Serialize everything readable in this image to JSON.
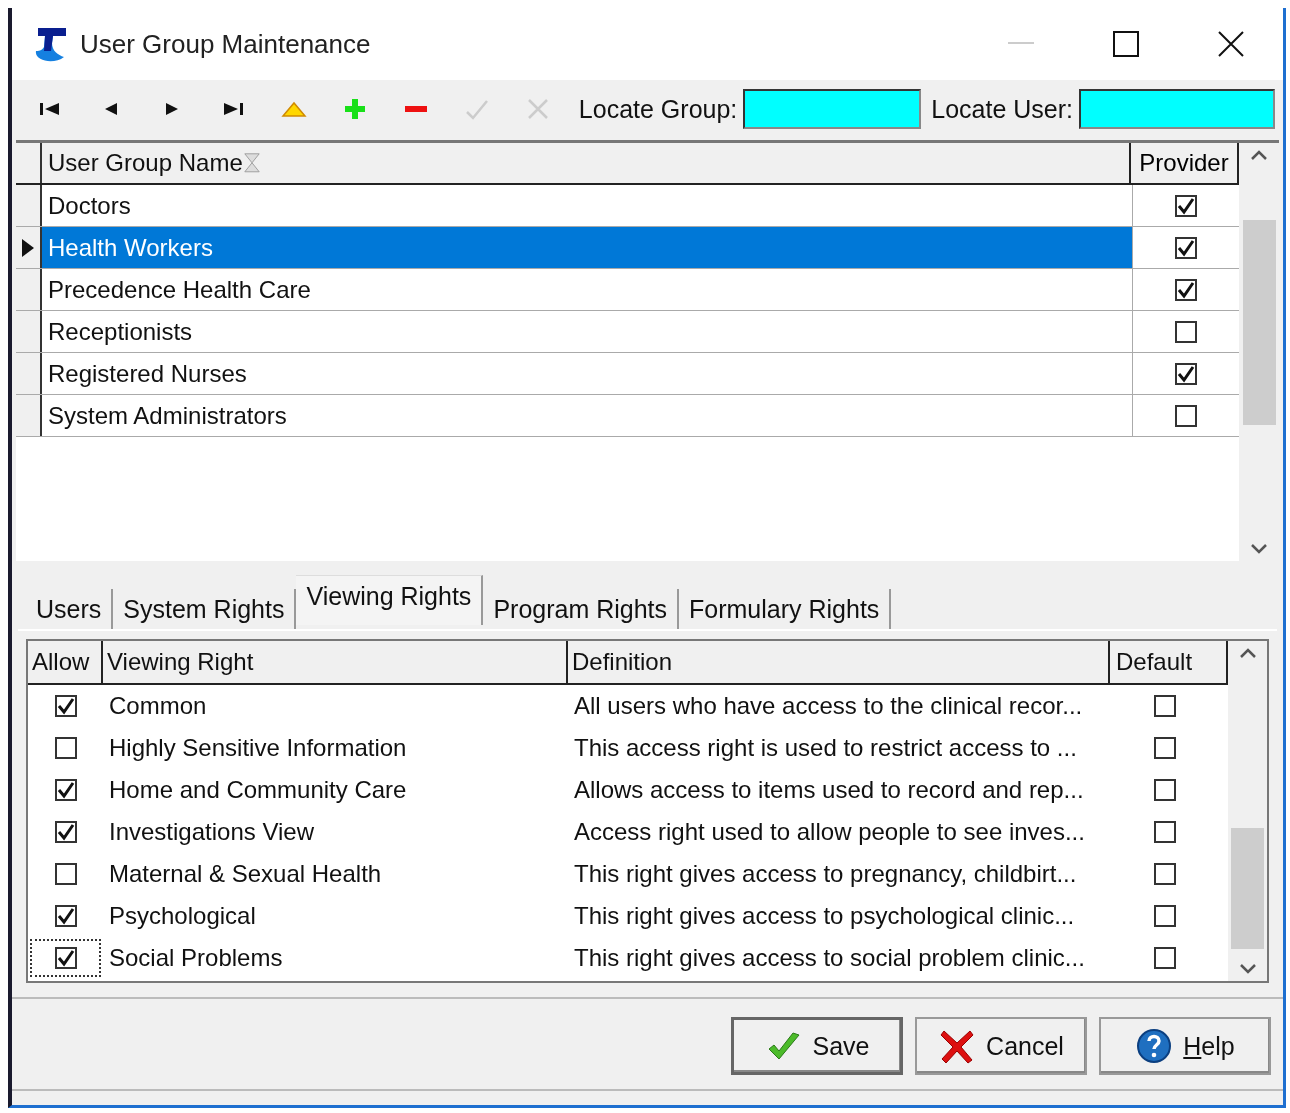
{
  "window": {
    "title": "User Group Maintenance"
  },
  "toolbar": {
    "buttons": [
      {
        "kind": "first",
        "disabled": false
      },
      {
        "kind": "prior",
        "disabled": false
      },
      {
        "kind": "next",
        "disabled": false
      },
      {
        "kind": "last",
        "disabled": false
      },
      {
        "kind": "edit",
        "disabled": false
      },
      {
        "kind": "insert",
        "disabled": false
      },
      {
        "kind": "delete",
        "disabled": false
      },
      {
        "kind": "post",
        "disabled": true
      },
      {
        "kind": "cancel",
        "disabled": true
      }
    ],
    "locate_group": {
      "label": "Locate Group:"
    },
    "locate_user": {
      "label": "Locate User:"
    }
  },
  "groups": {
    "columns": [
      "User Group Name",
      "Provider"
    ],
    "rows": [
      {
        "name": "Doctors",
        "provider": true,
        "selected": false
      },
      {
        "name": "Health Workers",
        "provider": true,
        "selected": true
      },
      {
        "name": "Precedence Health Care",
        "provider": true,
        "selected": false
      },
      {
        "name": "Receptionists",
        "provider": false,
        "selected": false
      },
      {
        "name": "Registered Nurses",
        "provider": true,
        "selected": false
      },
      {
        "name": "System Administrators",
        "provider": false,
        "selected": false
      }
    ]
  },
  "tabs": [
    {
      "label": "Users",
      "selected": false
    },
    {
      "label": "System Rights",
      "selected": false
    },
    {
      "label": "Viewing Rights",
      "selected": true
    },
    {
      "label": "Program Rights",
      "selected": false
    },
    {
      "label": "Formulary Rights",
      "selected": false
    }
  ],
  "rights": {
    "columns": [
      "Allow",
      "Viewing Right",
      "Definition",
      "Default"
    ],
    "rows": [
      {
        "allow": true,
        "focused": false,
        "name": "Common",
        "definition": "All users who have access to the clinical recor...",
        "default": false
      },
      {
        "allow": false,
        "focused": false,
        "name": "Highly Sensitive Information",
        "definition": "This access right is used to restrict access to ...",
        "default": false
      },
      {
        "allow": true,
        "focused": false,
        "name": "Home and Community Care",
        "definition": "Allows access to items used to record and rep...",
        "default": false
      },
      {
        "allow": true,
        "focused": false,
        "name": "Investigations View",
        "definition": "Access right used to allow people to see inves...",
        "default": false
      },
      {
        "allow": false,
        "focused": false,
        "name": "Maternal & Sexual Health",
        "definition": "This right gives access to pregnancy, childbirt...",
        "default": false
      },
      {
        "allow": true,
        "focused": false,
        "name": "Psychological",
        "definition": "This right gives access to psychological clinic...",
        "default": false
      },
      {
        "allow": true,
        "focused": true,
        "name": "Social Problems",
        "definition": "This right gives access to social problem clinic...",
        "default": false
      }
    ]
  },
  "buttons": [
    {
      "kind": "save",
      "label": "Save",
      "default": true,
      "underline_first": false
    },
    {
      "kind": "cancel",
      "label": "Cancel",
      "default": false,
      "underline_first": false
    },
    {
      "kind": "help",
      "label": "Help",
      "default": false,
      "underline_first": true
    }
  ]
}
